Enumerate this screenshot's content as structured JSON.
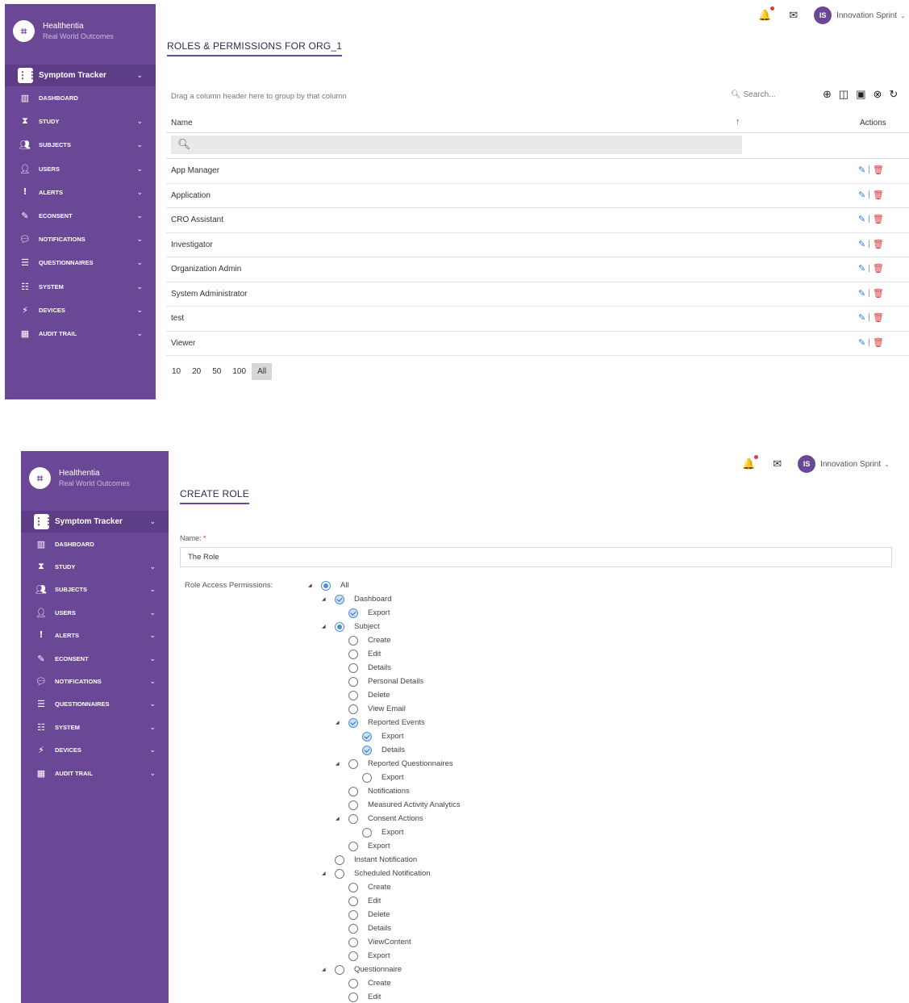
{
  "brand": {
    "logo": "⌗",
    "name": "Healthentia",
    "subtitle": "Real World Outcomes"
  },
  "sidebar": {
    "tracker_label": "Symptom Tracker",
    "items": [
      {
        "label": "DASHBOARD",
        "icon": "bar-chart-icon"
      },
      {
        "label": "STUDY",
        "icon": "hourglass-icon"
      },
      {
        "label": "SUBJECTS",
        "icon": "people-icon"
      },
      {
        "label": "USERS",
        "icon": "user-icon"
      },
      {
        "label": "ALERTS",
        "icon": "alert-icon"
      },
      {
        "label": "ECONSENT",
        "icon": "pencil-icon"
      },
      {
        "label": "NOTIFICATIONS",
        "icon": "chat-icon"
      },
      {
        "label": "QUESTIONNAIRES",
        "icon": "list-icon"
      },
      {
        "label": "SYSTEM",
        "icon": "sliders-icon"
      },
      {
        "label": "DEVICES",
        "icon": "plug-icon"
      },
      {
        "label": "AUDIT TRAIL",
        "icon": "audit-icon"
      }
    ]
  },
  "topbar": {
    "avatar_initials": "IS",
    "user_name": "Innovation Sprint"
  },
  "screen1": {
    "title": "ROLES & PERMISSIONS FOR ORG_1",
    "group_hint": "Drag a column header here to group by that column",
    "search_placeholder": "Search...",
    "col_name": "Name",
    "col_actions": "Actions",
    "rows": [
      "App Manager",
      "Application",
      "CRO Assistant",
      "Investigator",
      "Organization Admin",
      "System Administrator",
      "test",
      "Viewer"
    ],
    "page_sizes": [
      "10",
      "20",
      "50",
      "100",
      "All"
    ],
    "active_page_size": "All"
  },
  "screen2": {
    "title": "CREATE ROLE",
    "name_label": "Name:",
    "required_mark": "*",
    "name_value": "The Role",
    "permissions_label": "Role Access Permissions:",
    "tree": [
      {
        "label": "All",
        "level": 0,
        "state": "partial",
        "expanded": true
      },
      {
        "label": "Dashboard",
        "level": 1,
        "state": "checked",
        "expanded": true
      },
      {
        "label": "Export",
        "level": 2,
        "state": "checked"
      },
      {
        "label": "Subject",
        "level": 1,
        "state": "partial",
        "expanded": true
      },
      {
        "label": "Create",
        "level": 2,
        "state": "unchecked"
      },
      {
        "label": "Edit",
        "level": 2,
        "state": "unchecked"
      },
      {
        "label": "Details",
        "level": 2,
        "state": "unchecked"
      },
      {
        "label": "Personal Details",
        "level": 2,
        "state": "unchecked"
      },
      {
        "label": "Delete",
        "level": 2,
        "state": "unchecked"
      },
      {
        "label": "View Email",
        "level": 2,
        "state": "unchecked"
      },
      {
        "label": "Reported Events",
        "level": 2,
        "state": "checked",
        "expanded": true
      },
      {
        "label": "Export",
        "level": 3,
        "state": "checked"
      },
      {
        "label": "Details",
        "level": 3,
        "state": "checked"
      },
      {
        "label": "Reported Questionnaires",
        "level": 2,
        "state": "unchecked",
        "expanded": true
      },
      {
        "label": "Export",
        "level": 3,
        "state": "unchecked"
      },
      {
        "label": "Notifications",
        "level": 2,
        "state": "unchecked"
      },
      {
        "label": "Measured Activity Analytics",
        "level": 2,
        "state": "unchecked"
      },
      {
        "label": "Consent Actions",
        "level": 2,
        "state": "unchecked",
        "expanded": true
      },
      {
        "label": "Export",
        "level": 3,
        "state": "unchecked"
      },
      {
        "label": "Export",
        "level": 2,
        "state": "unchecked"
      },
      {
        "label": "Instant Notification",
        "level": 1,
        "state": "unchecked"
      },
      {
        "label": "Scheduled Notification",
        "level": 1,
        "state": "unchecked",
        "expanded": true
      },
      {
        "label": "Create",
        "level": 2,
        "state": "unchecked"
      },
      {
        "label": "Edit",
        "level": 2,
        "state": "unchecked"
      },
      {
        "label": "Delete",
        "level": 2,
        "state": "unchecked"
      },
      {
        "label": "Details",
        "level": 2,
        "state": "unchecked"
      },
      {
        "label": "ViewContent",
        "level": 2,
        "state": "unchecked"
      },
      {
        "label": "Export",
        "level": 2,
        "state": "unchecked"
      },
      {
        "label": "Questionnaire",
        "level": 1,
        "state": "unchecked",
        "expanded": true
      },
      {
        "label": "Create",
        "level": 2,
        "state": "unchecked"
      },
      {
        "label": "Edit",
        "level": 2,
        "state": "unchecked"
      }
    ]
  },
  "colors": {
    "sidebar": "#6b4896",
    "sidebar_dark": "#5c3d86",
    "accent": "#6b4896",
    "edit": "#2c7fd6",
    "delete": "#d83a3a",
    "check": "#4a90d9"
  }
}
